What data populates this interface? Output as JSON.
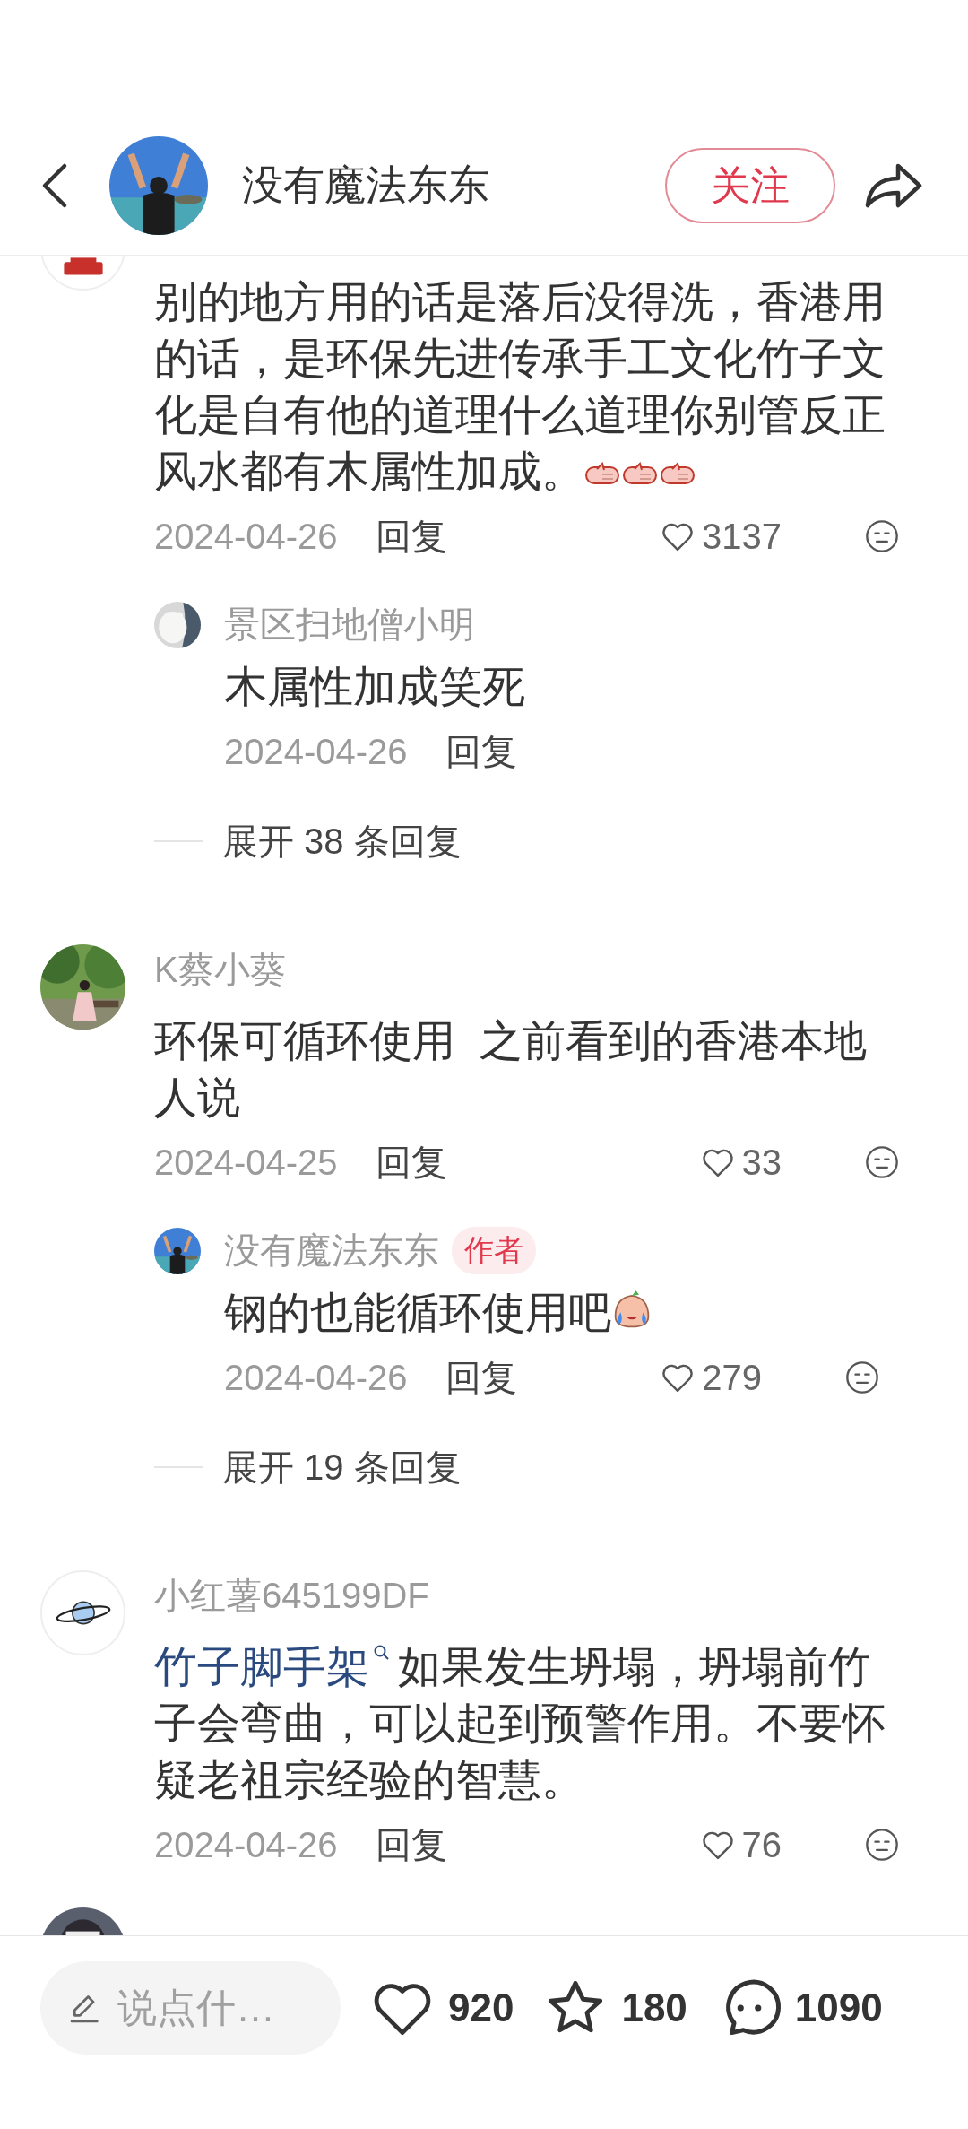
{
  "header": {
    "title": "没有魔法东东",
    "avatar": {
      "kind": "picture"
    },
    "follow_button": "关注"
  },
  "comments": [
    {
      "avatar": {
        "kind": "logo"
      },
      "text": "别的地方用的话是落后没得洗，香港用的话，是环保先进传承手工文化竹子文化是自有他的道理什么道理你别管反正风水都有木属性加成。",
      "emojis": [
        {
          "kind": "thumbs-up"
        },
        {
          "kind": "thumbs-up"
        },
        {
          "kind": "thumbs-up"
        }
      ],
      "date": "2024-04-26",
      "reply_label": "回复",
      "likes": "3137",
      "liked": false,
      "replies": [
        {
          "avatar": {
            "kind": "picture"
          },
          "name": "景区扫地僧小明",
          "text": "木属性加成笑死",
          "date": "2024-04-26",
          "reply_label": "回复"
        }
      ],
      "expand": "展开 38 条回复"
    },
    {
      "avatar": {
        "kind": "picture"
      },
      "name": "K蔡小葵",
      "text": "环保可循环使用  之前看到的香港本地人说",
      "date": "2024-04-25",
      "reply_label": "回复",
      "likes": "33",
      "liked": false,
      "replies": [
        {
          "avatar": {
            "kind": "picture"
          },
          "name": "没有魔法东东",
          "badge": "作者",
          "text": "钢的也能循环使用吧",
          "emojis": [
            {
              "kind": "crying-laugh"
            }
          ],
          "date": "2024-04-26",
          "reply_label": "回复",
          "likes": "279",
          "liked": false
        }
      ],
      "expand": "展开 19 条回复"
    },
    {
      "avatar": {
        "kind": "planet"
      },
      "name": "小红薯645199DF",
      "link": "竹子脚手架",
      "text": "如果发生坍塌，坍塌前竹子会弯曲，可以起到预警作用。不要怀疑老祖宗经验的智慧。",
      "date": "2024-04-26",
      "reply_label": "回复",
      "likes": "76",
      "liked": false
    },
    {
      "avatar": {
        "kind": "picture"
      }
    }
  ],
  "bottom_bar": {
    "input": {
      "placeholder": "说点什…"
    },
    "likes": "920",
    "favorites": "180",
    "comments_count": "1090"
  }
}
